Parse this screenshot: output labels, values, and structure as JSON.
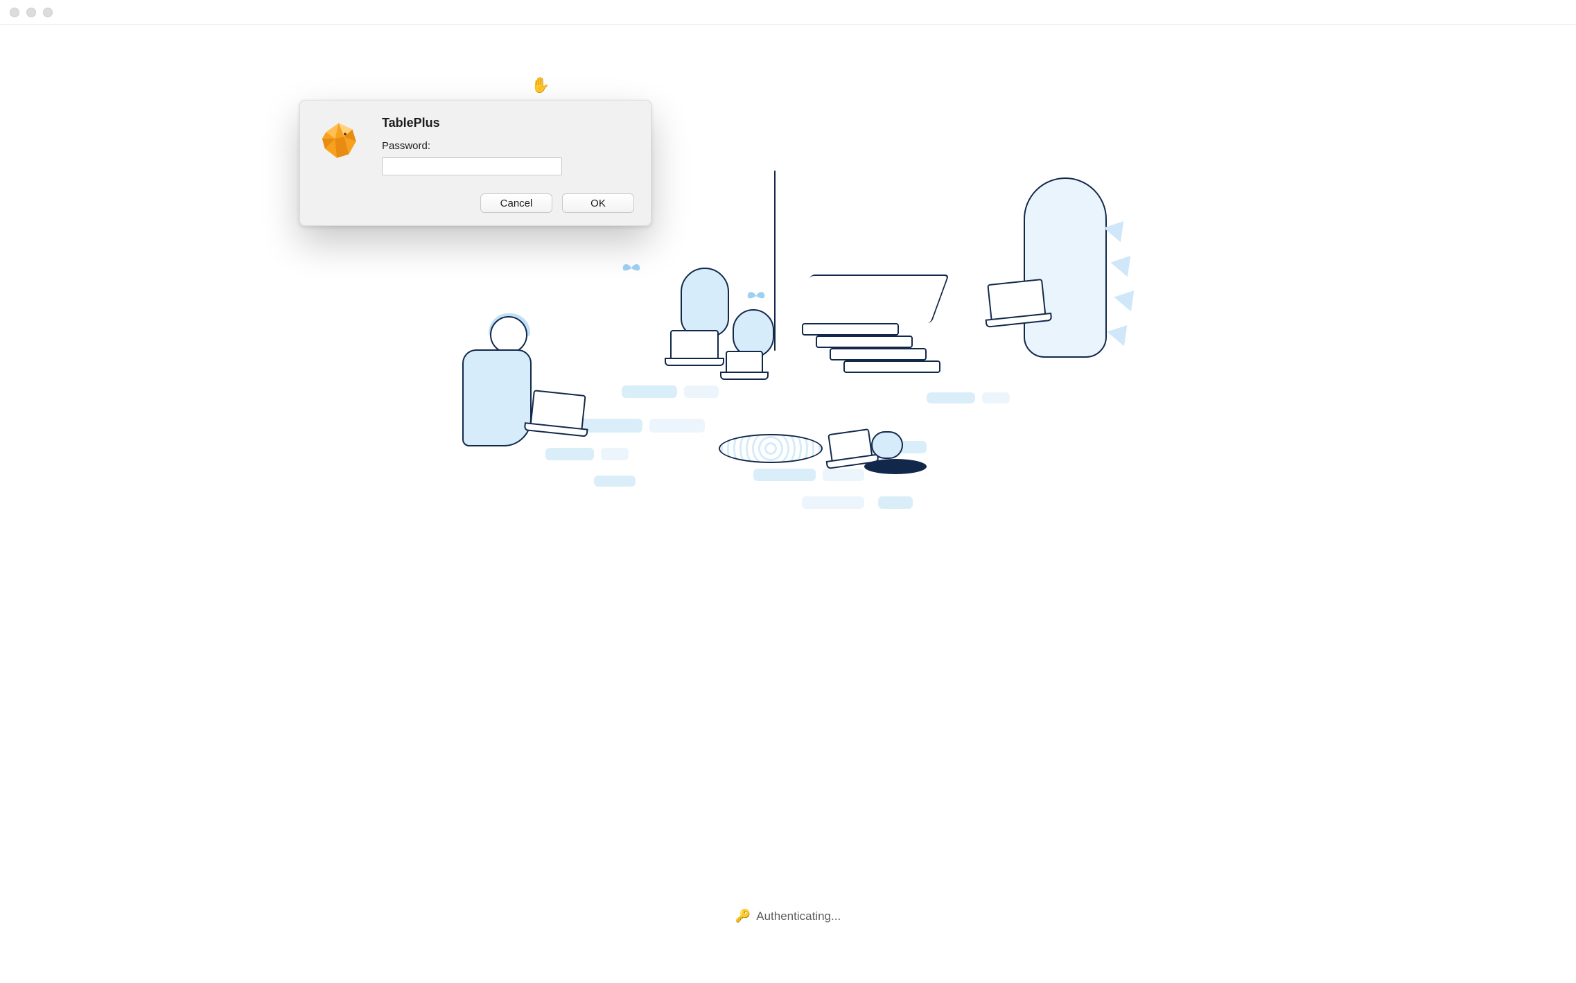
{
  "window": {
    "app_name": "TablePlus"
  },
  "dialog": {
    "title": "TablePlus",
    "password_label": "Password:",
    "password_value": "",
    "cancel_label": "Cancel",
    "ok_label": "OK"
  },
  "status": {
    "icon": "🔑",
    "text": "Authenticating..."
  },
  "cursor": {
    "glyph": "✋"
  },
  "colors": {
    "illustration_fill": "#d6ecfa",
    "illustration_stroke": "#12284a",
    "app_icon_primary": "#f7a11f",
    "app_icon_secondary": "#ffd27a"
  }
}
